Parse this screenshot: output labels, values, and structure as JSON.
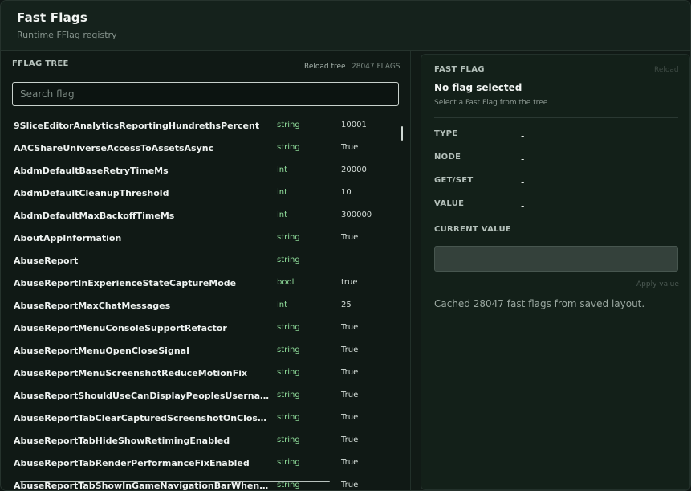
{
  "header": {
    "title": "Fast Flags",
    "subtitle": "Runtime FFlag registry"
  },
  "tree": {
    "title": "FFLAG TREE",
    "reload_label": "Reload tree",
    "count_label": "28047 FLAGS",
    "search_placeholder": "Search flag",
    "rows": [
      {
        "name": "9SliceEditorAnalyticsReportingHundrethsPercent",
        "type": "string",
        "value": "10001"
      },
      {
        "name": "AACShareUniverseAccessToAssetsAsync",
        "type": "string",
        "value": "True"
      },
      {
        "name": "AbdmDefaultBaseRetryTimeMs",
        "type": "int",
        "value": "20000"
      },
      {
        "name": "AbdmDefaultCleanupThreshold",
        "type": "int",
        "value": "10"
      },
      {
        "name": "AbdmDefaultMaxBackoffTimeMs",
        "type": "int",
        "value": "300000"
      },
      {
        "name": "AboutAppInformation",
        "type": "string",
        "value": "True"
      },
      {
        "name": "AbuseReport",
        "type": "string",
        "value": ""
      },
      {
        "name": "AbuseReportInExperienceStateCaptureMode",
        "type": "bool",
        "value": "true"
      },
      {
        "name": "AbuseReportMaxChatMessages",
        "type": "int",
        "value": "25"
      },
      {
        "name": "AbuseReportMenuConsoleSupportRefactor",
        "type": "string",
        "value": "True"
      },
      {
        "name": "AbuseReportMenuOpenCloseSignal",
        "type": "string",
        "value": "True"
      },
      {
        "name": "AbuseReportMenuScreenshotReduceMotionFix",
        "type": "string",
        "value": "True"
      },
      {
        "name": "AbuseReportShouldUseCanDisplayPeoplesUsernamesAp...",
        "type": "string",
        "value": "True"
      },
      {
        "name": "AbuseReportTabClearCapturedScreenshotOnCloseFix",
        "type": "string",
        "value": "True"
      },
      {
        "name": "AbuseReportTabHideShowRetimingEnabled",
        "type": "string",
        "value": "True"
      },
      {
        "name": "AbuseReportTabRenderPerformanceFixEnabled",
        "type": "string",
        "value": "True"
      },
      {
        "name": "AbuseReportTabShowInGameNavigationBarWhenSelected",
        "type": "string",
        "value": "True"
      }
    ]
  },
  "detail": {
    "title": "FAST FLAG",
    "reload_label": "Reload",
    "selected_title": "No flag selected",
    "hint": "Select a Fast Flag from the tree",
    "props": [
      {
        "label": "TYPE",
        "value": "-"
      },
      {
        "label": "NODE",
        "value": "-"
      },
      {
        "label": "GET/SET",
        "value": "-"
      },
      {
        "label": "VALUE",
        "value": "-"
      }
    ],
    "current_value_label": "CURRENT VALUE",
    "current_value": "",
    "apply_label": "Apply value",
    "status": "Cached 28047 fast flags from saved layout."
  },
  "colors": {
    "background": "#111a16",
    "accent_type": "#8fdc9a",
    "text_primary": "#eef2f0"
  }
}
